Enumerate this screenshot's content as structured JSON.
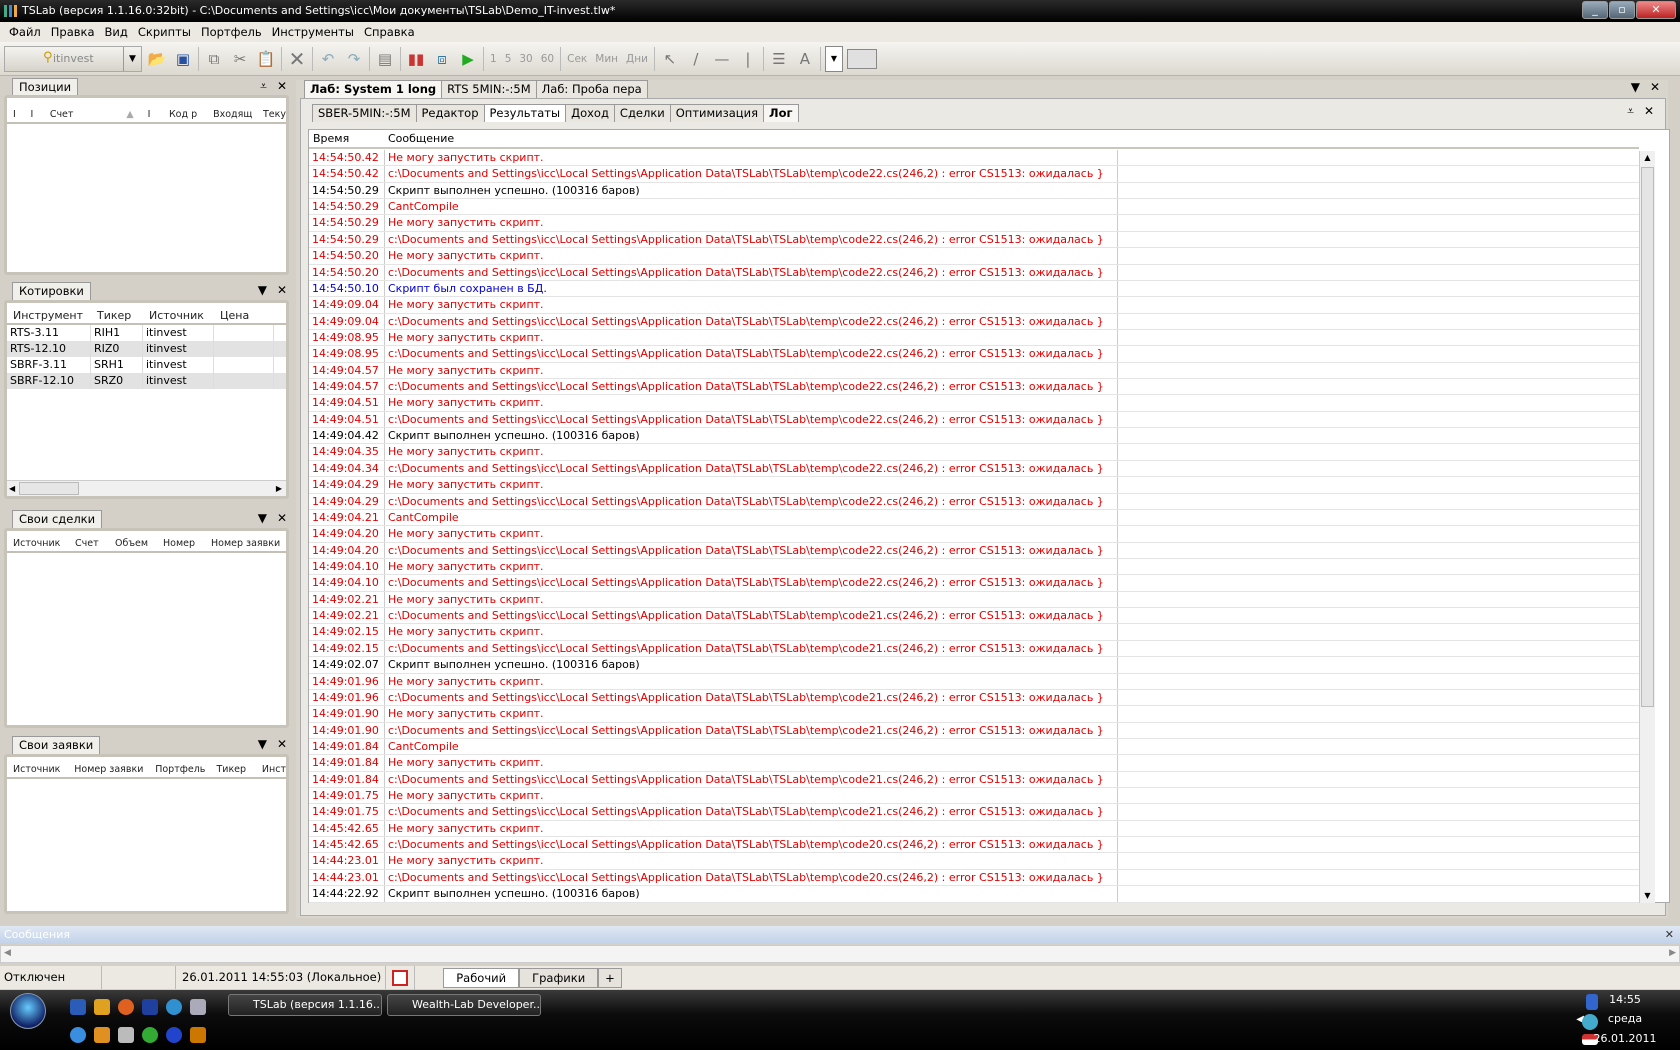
{
  "window": {
    "title": "TSLab (версия 1.1.16.0:32bit) - C:\\Documents and Settings\\icc\\Мои документы\\TSLab\\Demo_IT-invest.tlw*"
  },
  "menu": [
    "Файл",
    "Правка",
    "Вид",
    "Скрипты",
    "Портфель",
    "Инструменты",
    "Справка"
  ],
  "toolbar": {
    "account": "itinvest",
    "intervals": [
      "1",
      "5",
      "30",
      "60"
    ],
    "units": [
      "Сек",
      "Мин",
      "Дни"
    ]
  },
  "positions": {
    "tab": "Позиции",
    "columns": [
      "I",
      "I",
      "Счет",
      "",
      "I",
      "Код р",
      "Входящ",
      "Теку"
    ]
  },
  "quotes": {
    "tab": "Котировки",
    "columns": [
      "Инструмент",
      "Тикер",
      "Источник",
      "Цена"
    ],
    "rows": [
      [
        "RTS-3.11",
        "RIH1",
        "itinvest",
        ""
      ],
      [
        "RTS-12.10",
        "RIZ0",
        "itinvest",
        ""
      ],
      [
        "SBRF-3.11",
        "SRH1",
        "itinvest",
        ""
      ],
      [
        "SBRF-12.10",
        "SRZ0",
        "itinvest",
        ""
      ]
    ]
  },
  "trades": {
    "tab": "Свои сделки",
    "columns": [
      "Источник",
      "Счет",
      "Объем",
      "Номер",
      "Номер заявки"
    ]
  },
  "orders": {
    "tab": "Свои заявки",
    "columns": [
      "Источник",
      "Номер заявки",
      "Портфель",
      "Тикер",
      "Инст"
    ]
  },
  "main": {
    "tabs": [
      "Лаб: System 1 long",
      "RTS 5MIN:-:5M",
      "Лаб: Проба пера"
    ],
    "subtabs": [
      "SBER-5MIN:-:5M",
      "Редактор",
      "Результаты",
      "Доход",
      "Сделки",
      "Оптимизация",
      "Лог"
    ],
    "columns": {
      "time": "Время",
      "message": "Сообщение"
    }
  },
  "log": [
    [
      "14:54:50.42",
      "Не могу запустить скрипт.",
      "error"
    ],
    [
      "14:54:50.42",
      "c:\\Documents and Settings\\icc\\Local Settings\\Application Data\\TSLab\\TSLab\\temp\\code22.cs(246,2) : error CS1513: ожидалась }",
      "error"
    ],
    [
      "14:54:50.29",
      "Скрипт выполнен успешно. (100316 баров)",
      "info"
    ],
    [
      "14:54:50.29",
      "CantCompile",
      "error"
    ],
    [
      "14:54:50.29",
      "Не могу запустить скрипт.",
      "error"
    ],
    [
      "14:54:50.29",
      "c:\\Documents and Settings\\icc\\Local Settings\\Application Data\\TSLab\\TSLab\\temp\\code22.cs(246,2) : error CS1513: ожидалась }",
      "error"
    ],
    [
      "14:54:50.20",
      "Не могу запустить скрипт.",
      "error"
    ],
    [
      "14:54:50.20",
      "c:\\Documents and Settings\\icc\\Local Settings\\Application Data\\TSLab\\TSLab\\temp\\code22.cs(246,2) : error CS1513: ожидалась }",
      "error"
    ],
    [
      "14:54:50.10",
      "Скрипт был сохранен в БД.",
      "saved"
    ],
    [
      "14:49:09.04",
      "Не могу запустить скрипт.",
      "error"
    ],
    [
      "14:49:09.04",
      "c:\\Documents and Settings\\icc\\Local Settings\\Application Data\\TSLab\\TSLab\\temp\\code22.cs(246,2) : error CS1513: ожидалась }",
      "error"
    ],
    [
      "14:49:08.95",
      "Не могу запустить скрипт.",
      "error"
    ],
    [
      "14:49:08.95",
      "c:\\Documents and Settings\\icc\\Local Settings\\Application Data\\TSLab\\TSLab\\temp\\code22.cs(246,2) : error CS1513: ожидалась }",
      "error"
    ],
    [
      "14:49:04.57",
      "Не могу запустить скрипт.",
      "error"
    ],
    [
      "14:49:04.57",
      "c:\\Documents and Settings\\icc\\Local Settings\\Application Data\\TSLab\\TSLab\\temp\\code22.cs(246,2) : error CS1513: ожидалась }",
      "error"
    ],
    [
      "14:49:04.51",
      "Не могу запустить скрипт.",
      "error"
    ],
    [
      "14:49:04.51",
      "c:\\Documents and Settings\\icc\\Local Settings\\Application Data\\TSLab\\TSLab\\temp\\code22.cs(246,2) : error CS1513: ожидалась }",
      "error"
    ],
    [
      "14:49:04.42",
      "Скрипт выполнен успешно. (100316 баров)",
      "info"
    ],
    [
      "14:49:04.35",
      "Не могу запустить скрипт.",
      "error"
    ],
    [
      "14:49:04.34",
      "c:\\Documents and Settings\\icc\\Local Settings\\Application Data\\TSLab\\TSLab\\temp\\code22.cs(246,2) : error CS1513: ожидалась }",
      "error"
    ],
    [
      "14:49:04.29",
      "Не могу запустить скрипт.",
      "error"
    ],
    [
      "14:49:04.29",
      "c:\\Documents and Settings\\icc\\Local Settings\\Application Data\\TSLab\\TSLab\\temp\\code22.cs(246,2) : error CS1513: ожидалась }",
      "error"
    ],
    [
      "14:49:04.21",
      "CantCompile",
      "error"
    ],
    [
      "14:49:04.20",
      "Не могу запустить скрипт.",
      "error"
    ],
    [
      "14:49:04.20",
      "c:\\Documents and Settings\\icc\\Local Settings\\Application Data\\TSLab\\TSLab\\temp\\code22.cs(246,2) : error CS1513: ожидалась }",
      "error"
    ],
    [
      "14:49:04.10",
      "Не могу запустить скрипт.",
      "error"
    ],
    [
      "14:49:04.10",
      "c:\\Documents and Settings\\icc\\Local Settings\\Application Data\\TSLab\\TSLab\\temp\\code22.cs(246,2) : error CS1513: ожидалась }",
      "error"
    ],
    [
      "14:49:02.21",
      "Не могу запустить скрипт.",
      "error"
    ],
    [
      "14:49:02.21",
      "c:\\Documents and Settings\\icc\\Local Settings\\Application Data\\TSLab\\TSLab\\temp\\code21.cs(246,2) : error CS1513: ожидалась }",
      "error"
    ],
    [
      "14:49:02.15",
      "Не могу запустить скрипт.",
      "error"
    ],
    [
      "14:49:02.15",
      "c:\\Documents and Settings\\icc\\Local Settings\\Application Data\\TSLab\\TSLab\\temp\\code21.cs(246,2) : error CS1513: ожидалась }",
      "error"
    ],
    [
      "14:49:02.07",
      "Скрипт выполнен успешно. (100316 баров)",
      "info"
    ],
    [
      "14:49:01.96",
      "Не могу запустить скрипт.",
      "error"
    ],
    [
      "14:49:01.96",
      "c:\\Documents and Settings\\icc\\Local Settings\\Application Data\\TSLab\\TSLab\\temp\\code21.cs(246,2) : error CS1513: ожидалась }",
      "error"
    ],
    [
      "14:49:01.90",
      "Не могу запустить скрипт.",
      "error"
    ],
    [
      "14:49:01.90",
      "c:\\Documents and Settings\\icc\\Local Settings\\Application Data\\TSLab\\TSLab\\temp\\code21.cs(246,2) : error CS1513: ожидалась }",
      "error"
    ],
    [
      "14:49:01.84",
      "CantCompile",
      "error"
    ],
    [
      "14:49:01.84",
      "Не могу запустить скрипт.",
      "error"
    ],
    [
      "14:49:01.84",
      "c:\\Documents and Settings\\icc\\Local Settings\\Application Data\\TSLab\\TSLab\\temp\\code21.cs(246,2) : error CS1513: ожидалась }",
      "error"
    ],
    [
      "14:49:01.75",
      "Не могу запустить скрипт.",
      "error"
    ],
    [
      "14:49:01.75",
      "c:\\Documents and Settings\\icc\\Local Settings\\Application Data\\TSLab\\TSLab\\temp\\code21.cs(246,2) : error CS1513: ожидалась }",
      "error"
    ],
    [
      "14:45:42.65",
      "Не могу запустить скрипт.",
      "error"
    ],
    [
      "14:45:42.65",
      "c:\\Documents and Settings\\icc\\Local Settings\\Application Data\\TSLab\\TSLab\\temp\\code20.cs(246,2) : error CS1513: ожидалась }",
      "error"
    ],
    [
      "14:44:23.01",
      "Не могу запустить скрипт.",
      "error"
    ],
    [
      "14:44:23.01",
      "c:\\Documents and Settings\\icc\\Local Settings\\Application Data\\TSLab\\TSLab\\temp\\code20.cs(246,2) : error CS1513: ожидалась }",
      "error"
    ],
    [
      "14:44:22.92",
      "Скрипт выполнен успешно. (100316 баров)",
      "info"
    ]
  ],
  "messages": {
    "title": "Сообщения"
  },
  "status": {
    "connection": "Отключен",
    "datetime": "26.01.2011 14:55:03 (Локальное)",
    "tabs": [
      "Рабочий",
      "Графики"
    ],
    "add": "+"
  },
  "taskbar": {
    "tasks": [
      "TSLab (версия 1.1.16...",
      "Wealth-Lab Developer..."
    ],
    "time": "14:55",
    "day": "среда",
    "date": "26.01.2011"
  }
}
